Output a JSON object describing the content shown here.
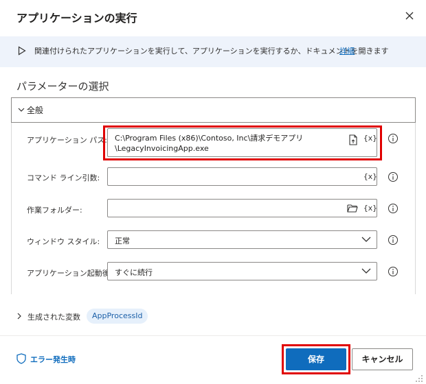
{
  "dialog": {
    "title": "アプリケーションの実行",
    "info": {
      "text": "関連付けられたアプリケーションを実行して、アプリケーションを実行するか、ドキュメントを開きます",
      "link": "詳細"
    },
    "section_title": "パラメーターの選択",
    "group": {
      "label": "全般"
    },
    "fields": {
      "app_path": {
        "label": "アプリケーション パス:",
        "value_line1": "C:\\Program Files (x86)\\Contoso, Inc\\請求デモアプリ",
        "value_line2": "\\LegacyInvoicingApp.exe",
        "var_symbol": "{x}"
      },
      "cmd_args": {
        "label": "コマンド ライン引数:",
        "value": "",
        "var_symbol": "{x}"
      },
      "work_folder": {
        "label": "作業フォルダー:",
        "value": "",
        "var_symbol": "{x}"
      },
      "window_style": {
        "label": "ウィンドウ スタイル:",
        "value": "正常"
      },
      "after_launch": {
        "label": "アプリケーション起動後:",
        "value": "すぐに続行"
      }
    },
    "generated_vars": {
      "label": "生成された変数",
      "badge": "AppProcessId"
    },
    "footer": {
      "error_link": "エラー発生時",
      "save": "保存",
      "cancel": "キャンセル"
    }
  }
}
